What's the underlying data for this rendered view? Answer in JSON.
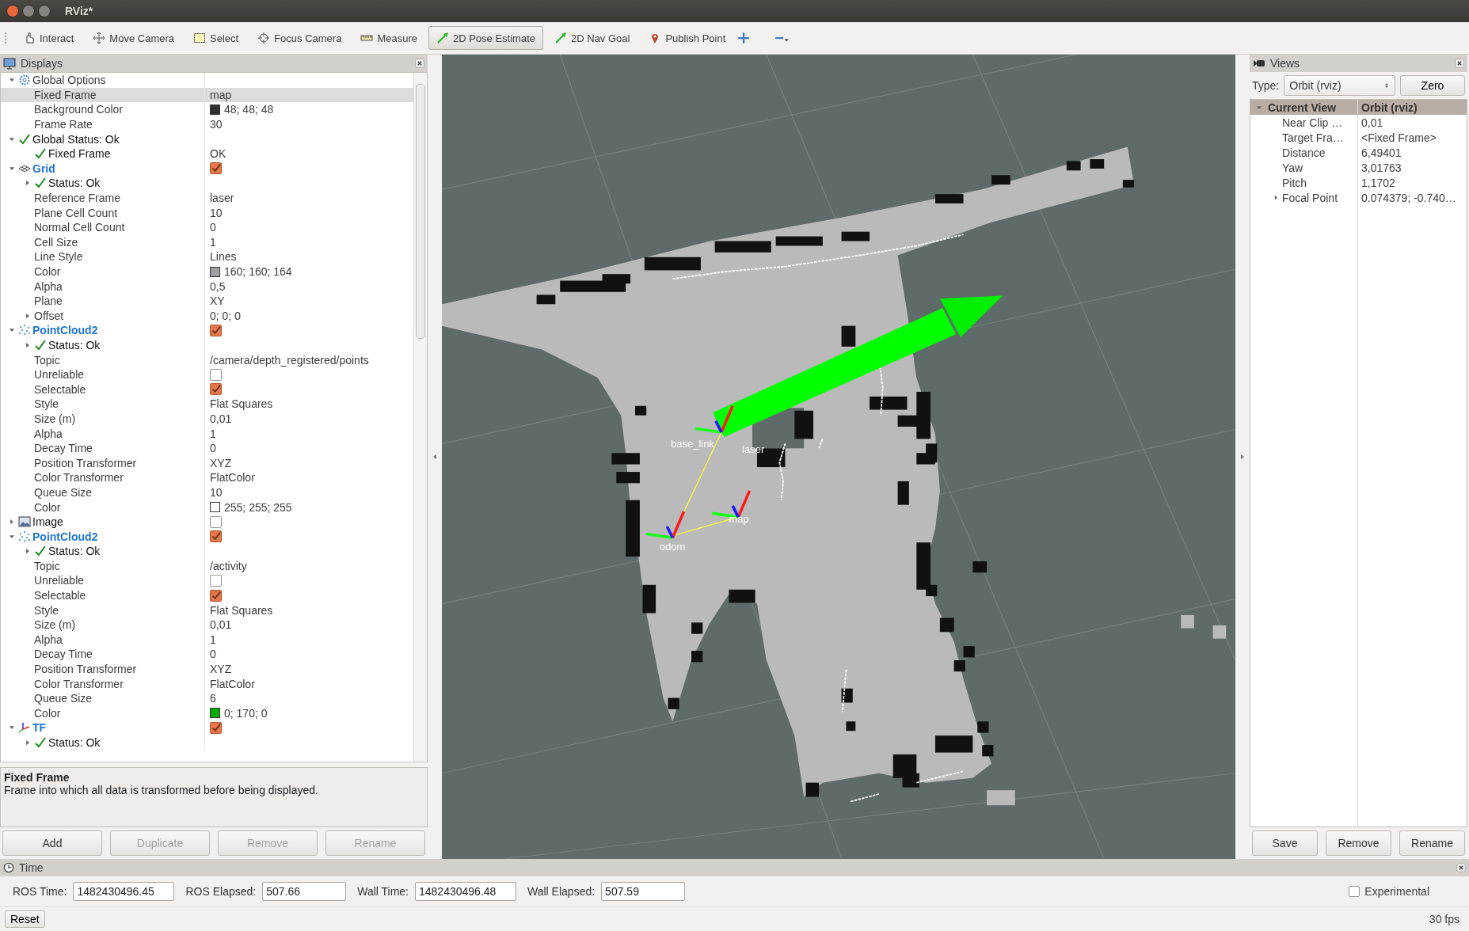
{
  "window": {
    "title": "RViz*"
  },
  "toolbar": {
    "tools": [
      {
        "kind": "interact",
        "label": "Interact",
        "selected": false
      },
      {
        "kind": "move",
        "label": "Move Camera",
        "selected": false
      },
      {
        "kind": "select",
        "label": "Select",
        "selected": false
      },
      {
        "kind": "focus",
        "label": "Focus Camera",
        "selected": false
      },
      {
        "kind": "measure",
        "label": "Measure",
        "selected": false
      },
      {
        "kind": "pose",
        "label": "2D Pose Estimate",
        "selected": true
      },
      {
        "kind": "goal",
        "label": "2D Nav Goal",
        "selected": false
      },
      {
        "kind": "point",
        "label": "Publish Point",
        "selected": false
      }
    ]
  },
  "displays": {
    "title": "Displays",
    "tree": [
      {
        "kind": "options",
        "label": "Global Options",
        "expanded": true,
        "selected": false,
        "children": [
          {
            "kind": "property",
            "label": "Fixed Frame",
            "value": "map",
            "selected": true
          },
          {
            "kind": "property",
            "label": "Background Color",
            "value": "48; 48; 48",
            "color": "#303030",
            "selected": false
          },
          {
            "kind": "property",
            "label": "Frame Rate",
            "value": "30",
            "selected": false
          }
        ]
      },
      {
        "kind": "status",
        "label": "Global Status: Ok",
        "expanded": true,
        "selected": false,
        "children": [
          {
            "kind": "status",
            "label": "Fixed Frame",
            "value": "OK",
            "selected": false
          }
        ]
      },
      {
        "kind": "grid",
        "label": "Grid",
        "expanded": true,
        "checked": true,
        "selected": false,
        "children": [
          {
            "kind": "status",
            "label": "Status: Ok",
            "expanded": false,
            "selected": false
          },
          {
            "kind": "property",
            "label": "Reference Frame",
            "value": "laser",
            "selected": false
          },
          {
            "kind": "property",
            "label": "Plane Cell Count",
            "value": "10",
            "selected": false
          },
          {
            "kind": "property",
            "label": "Normal Cell Count",
            "value": "0",
            "selected": false
          },
          {
            "kind": "property",
            "label": "Cell Size",
            "value": "1",
            "selected": false
          },
          {
            "kind": "property",
            "label": "Line Style",
            "value": "Lines",
            "selected": false
          },
          {
            "kind": "property",
            "label": "Color",
            "value": "160; 160; 164",
            "color": "#a0a0a4",
            "selected": false
          },
          {
            "kind": "property",
            "label": "Alpha",
            "value": "0,5",
            "selected": false
          },
          {
            "kind": "property",
            "label": "Plane",
            "value": "XY",
            "selected": false
          },
          {
            "kind": "property",
            "label": "Offset",
            "value": "0; 0; 0",
            "expanded": false,
            "selected": false
          }
        ]
      },
      {
        "kind": "pointcloud",
        "label": "PointCloud2",
        "expanded": true,
        "checked": true,
        "selected": false,
        "children": [
          {
            "kind": "status",
            "label": "Status: Ok",
            "expanded": false,
            "selected": false
          },
          {
            "kind": "property",
            "label": "Topic",
            "value": "/camera/depth_registered/points",
            "selected": false
          },
          {
            "kind": "property",
            "label": "Unreliable",
            "checked": false,
            "selected": false
          },
          {
            "kind": "property",
            "label": "Selectable",
            "checked": true,
            "selected": false
          },
          {
            "kind": "property",
            "label": "Style",
            "value": "Flat Squares",
            "selected": false
          },
          {
            "kind": "property",
            "label": "Size (m)",
            "value": "0,01",
            "selected": false
          },
          {
            "kind": "property",
            "label": "Alpha",
            "value": "1",
            "selected": false
          },
          {
            "kind": "property",
            "label": "Decay Time",
            "value": "0",
            "selected": false
          },
          {
            "kind": "property",
            "label": "Position Transformer",
            "value": "XYZ",
            "selected": false
          },
          {
            "kind": "property",
            "label": "Color Transformer",
            "value": "FlatColor",
            "selected": false
          },
          {
            "kind": "property",
            "label": "Queue Size",
            "value": "10",
            "selected": false
          },
          {
            "kind": "property",
            "label": "Color",
            "value": "255; 255; 255",
            "color": "#ffffff",
            "selected": false
          }
        ]
      },
      {
        "kind": "image",
        "label": "Image",
        "expanded": false,
        "checked": false,
        "selected": false
      },
      {
        "kind": "pointcloud",
        "label": "PointCloud2",
        "expanded": true,
        "checked": true,
        "selected": false,
        "children": [
          {
            "kind": "status",
            "label": "Status: Ok",
            "expanded": false,
            "selected": false
          },
          {
            "kind": "property",
            "label": "Topic",
            "value": "/activity",
            "selected": false
          },
          {
            "kind": "property",
            "label": "Unreliable",
            "checked": false,
            "selected": false
          },
          {
            "kind": "property",
            "label": "Selectable",
            "checked": true,
            "selected": false
          },
          {
            "kind": "property",
            "label": "Style",
            "value": "Flat Squares",
            "selected": false
          },
          {
            "kind": "property",
            "label": "Size (m)",
            "value": "0,01",
            "selected": false
          },
          {
            "kind": "property",
            "label": "Alpha",
            "value": "1",
            "selected": false
          },
          {
            "kind": "property",
            "label": "Decay Time",
            "value": "0",
            "selected": false
          },
          {
            "kind": "property",
            "label": "Position Transformer",
            "value": "XYZ",
            "selected": false
          },
          {
            "kind": "property",
            "label": "Color Transformer",
            "value": "FlatColor",
            "selected": false
          },
          {
            "kind": "property",
            "label": "Queue Size",
            "value": "6",
            "selected": false
          },
          {
            "kind": "property",
            "label": "Color",
            "value": "0; 170; 0",
            "color": "#00aa00",
            "selected": false
          }
        ]
      },
      {
        "kind": "tf",
        "label": "TF",
        "expanded": true,
        "checked": true,
        "selected": false,
        "children": [
          {
            "kind": "status",
            "label": "Status: Ok",
            "expanded": false,
            "selected": false
          }
        ]
      }
    ],
    "description": {
      "title": "Fixed Frame",
      "text": "Frame into which all data is transformed before being displayed."
    },
    "buttons": [
      {
        "label": "Add",
        "disabled": false
      },
      {
        "label": "Duplicate",
        "disabled": true
      },
      {
        "label": "Remove",
        "disabled": true
      },
      {
        "label": "Rename",
        "disabled": true
      }
    ]
  },
  "viewport": {
    "frames": [
      {
        "label": "base_link"
      },
      {
        "label": "laser"
      },
      {
        "label": "odom"
      },
      {
        "label": "map"
      }
    ]
  },
  "views": {
    "title": "Views",
    "type_label": "Type:",
    "type": "Orbit (rviz)",
    "zero_button": "Zero",
    "current": {
      "label": "Current View",
      "value": "Orbit (rviz)",
      "expanded": true
    },
    "rows": [
      {
        "label": "Near Clip …",
        "value": "0,01"
      },
      {
        "label": "Target Fra…",
        "value": "<Fixed Frame>"
      },
      {
        "label": "Distance",
        "value": "6,49401"
      },
      {
        "label": "Yaw",
        "value": "3,01763"
      },
      {
        "label": "Pitch",
        "value": "1,1702"
      },
      {
        "label": "Focal Point",
        "value": "0.074379; -0.740…",
        "expanded": false
      }
    ],
    "buttons": [
      "Save",
      "Remove",
      "Rename"
    ]
  },
  "time": {
    "title": "Time",
    "fields": [
      {
        "label": "ROS Time:",
        "value": "1482430496.45"
      },
      {
        "label": "ROS Elapsed:",
        "value": "507.66"
      },
      {
        "label": "Wall Time:",
        "value": "1482430496.48"
      },
      {
        "label": "Wall Elapsed:",
        "value": "507.59"
      }
    ],
    "experimental": {
      "label": "Experimental",
      "checked": false
    }
  },
  "status_bar": {
    "reset": "Reset",
    "fps": "30 fps"
  }
}
